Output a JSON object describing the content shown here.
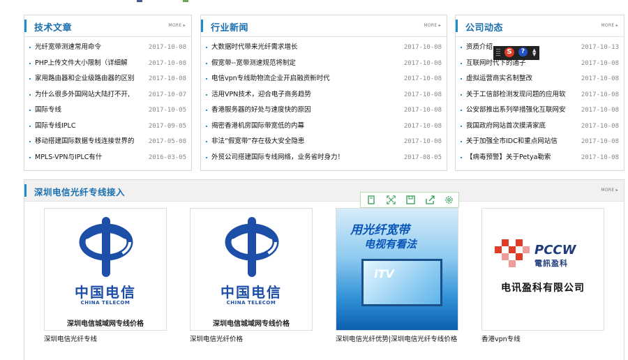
{
  "panels": [
    {
      "title": "技术文章",
      "more": "MORE ▸",
      "items": [
        {
          "title": "光纤宽带测速常用命令",
          "date": "2017-10-08"
        },
        {
          "title": "PHP上传文件大小限制（详细解",
          "date": "2017-10-08"
        },
        {
          "title": "家用路由器和企业级路由器的区别",
          "date": "2017-10-08"
        },
        {
          "title": "为什么很多外国网站大陆打不开,",
          "date": "2017-10-07"
        },
        {
          "title": "国际专线",
          "date": "2017-10-05"
        },
        {
          "title": "国际专线IPLC",
          "date": "2017-09-05"
        },
        {
          "title": "移动搭建国际数据专线连接世界的",
          "date": "2017-05-08"
        },
        {
          "title": "MPLS-VPN与IPLC有什",
          "date": "2016-03-05"
        }
      ]
    },
    {
      "title": "行业新闻",
      "more": "MORE ▸",
      "items": [
        {
          "title": "大数据时代带来光纤需求增长",
          "date": "2017-10-08"
        },
        {
          "title": "假宽带--宽带测速规范将制定",
          "date": "2017-10-08"
        },
        {
          "title": "电信vpn专线助物流企业开启融资新时代",
          "date": "2017-10-08"
        },
        {
          "title": "活用VPN技术，迎合电子商务趋势",
          "date": "2017-10-08"
        },
        {
          "title": "香港服务器的好处与速度快的原因",
          "date": "2017-10-08"
        },
        {
          "title": "揭密香港机房国际带宽低的内幕",
          "date": "2017-10-08"
        },
        {
          "title": "非法“假宽带”存在极大安全隐患",
          "date": "2017-10-08"
        },
        {
          "title": "外贸公司搭建国际专线网络，业务省时身力！",
          "date": "2017-08-05"
        }
      ]
    },
    {
      "title": "公司动态",
      "more": "MORE ▸",
      "items": [
        {
          "title": "资质介绍",
          "date": "2017-10-13"
        },
        {
          "title": "互联网时代下的通子",
          "date": "2017-10-08"
        },
        {
          "title": "虚拟运营商实名制整改",
          "date": "2017-10-08"
        },
        {
          "title": "关于工信部检测发现问题的应用软",
          "date": "2017-10-08"
        },
        {
          "title": "公安部推出系列举措强化互联网安",
          "date": "2017-10-08"
        },
        {
          "title": "我国政府网站首次摸清家底",
          "date": "2017-10-08"
        },
        {
          "title": "关于加强全市IDC和重点网站信",
          "date": "2017-10-08"
        },
        {
          "title": "【病毒预警】关于Petya勒索",
          "date": "2017-10-08"
        }
      ]
    }
  ],
  "showcase": {
    "title": "深圳电信光纤专线接入",
    "more": "MORE ▸",
    "cards": [
      {
        "caption": "深圳电信光纤专线",
        "logo_cn": "中国电信",
        "logo_en": "CHINA TELECOM",
        "subtitle": "深圳电信城域网专线价格"
      },
      {
        "caption": "深圳电信光纤价格",
        "logo_cn": "中国电信",
        "logo_en": "CHINA TELECOM",
        "subtitle": "深圳电信城域网专线价格"
      },
      {
        "caption": "深圳电信光纤优势|深圳电信光纤专线价格",
        "ad_title1": "用光纤宽带",
        "ad_title2": "电视有看法",
        "ad_tv": "iTV"
      },
      {
        "caption": "香港vpn专线",
        "logo_name": "PCCW",
        "logo_cn": "電訊盈科",
        "company": "电讯盈科有限公司"
      }
    ]
  },
  "colors": {
    "accent": "#1a6fb0",
    "telecom_blue": "#1d4fa8",
    "border": "#d9d9d9"
  },
  "toolbar_icons": [
    "copy-icon",
    "fullscreen-icon",
    "save-icon",
    "share-icon",
    "settings-icon"
  ],
  "overlay": {
    "s_label": "S",
    "help_label": "?"
  }
}
